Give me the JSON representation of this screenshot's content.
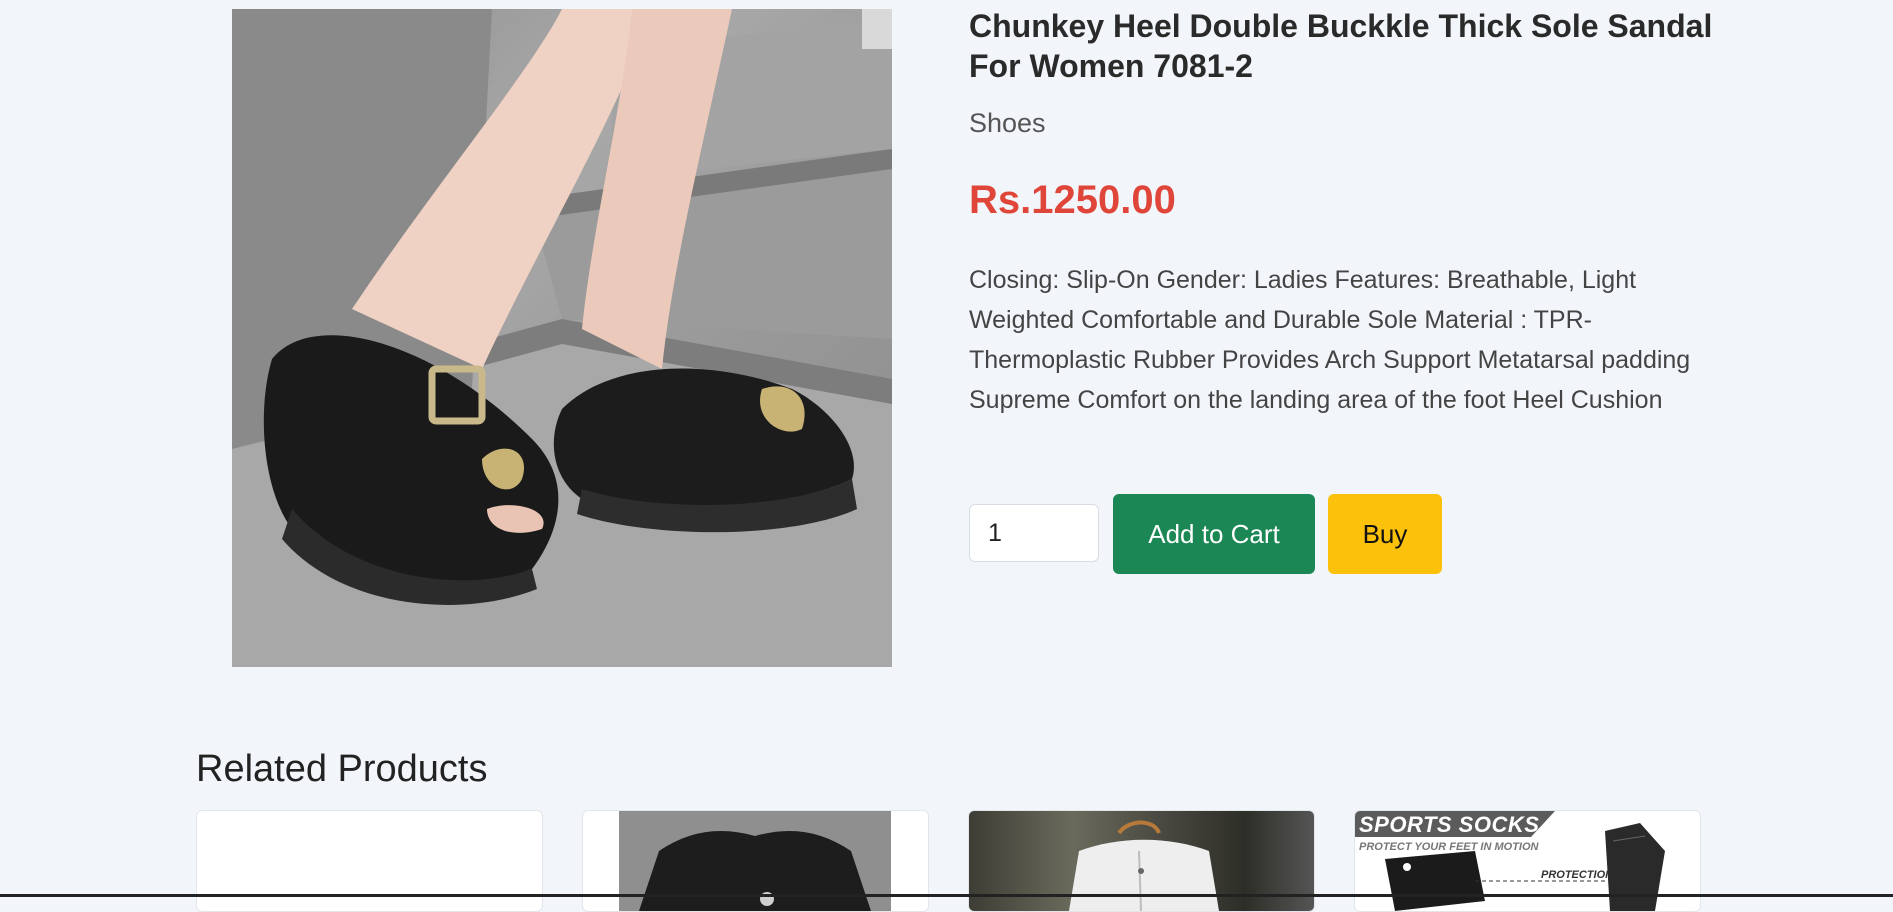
{
  "product": {
    "title": "Chunkey Heel Double Buckkle Thick Sole Sandal For Women 7081-2",
    "category": "Shoes",
    "price": "Rs.1250.00",
    "description": "Closing: Slip-On Gender: Ladies Features: Breathable, Light Weighted Comfortable and Durable Sole Material : TPR-Thermoplastic Rubber Provides Arch Support Metatarsal padding Supreme Comfort on the landing area of the foot Heel Cushion",
    "quantity": "1",
    "add_to_cart_label": "Add to Cart",
    "buy_label": "Buy"
  },
  "related": {
    "heading": "Related Products",
    "cards": [
      {
        "image": "blank"
      },
      {
        "image": "black t-shirt"
      },
      {
        "image": "white jacket on hanger"
      },
      {
        "image": "sports socks",
        "banner": "SPORTS SOCKS",
        "subtitle": "PROTECT YOUR FEET IN MOTION",
        "tag": "PROTECTION"
      }
    ]
  },
  "colors": {
    "page_bg": "#f2f6fb",
    "price": "#e0453a",
    "cart_button": "#1b8754",
    "buy_button": "#fbc10b"
  }
}
